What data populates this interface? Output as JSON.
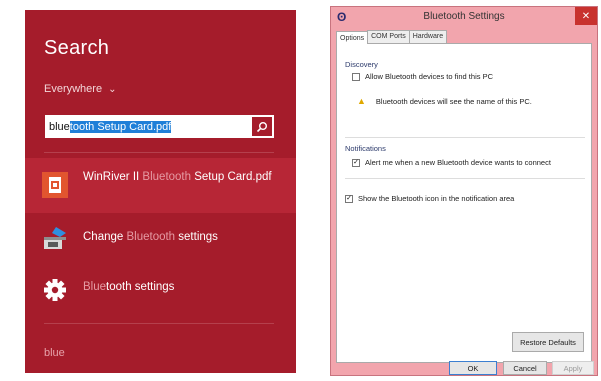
{
  "search": {
    "title": "Search",
    "scope": "Everywhere",
    "query_typed": "blue",
    "query_autocomplete": "tooth Setup Card.pdf",
    "results": [
      {
        "icon": "pdf-file-icon",
        "text_main": "WinRiver II ",
        "text_dim": "Bluetooth",
        "text_after": " Setup Card.pdf"
      },
      {
        "icon": "bluetooth-settings-icon",
        "text_main": "Change ",
        "text_dim": "Bluetooth",
        "text_after": " settings"
      },
      {
        "icon": "gear-icon",
        "text_main": "",
        "text_dim": "Blue",
        "text_after": "tooth settings"
      }
    ],
    "typed_footer": "blue"
  },
  "dialog": {
    "title": "Bluetooth Settings",
    "close_label": "✕",
    "tabs": [
      "Options",
      "COM Ports",
      "Hardware"
    ],
    "discovery": {
      "title": "Discovery",
      "allow_label": "Allow Bluetooth devices to find this PC",
      "allow_checked": false,
      "warning": "Bluetooth devices will see the name of this PC."
    },
    "notifications": {
      "title": "Notifications",
      "alert_label": "Alert me when a new Bluetooth device wants to connect",
      "alert_checked": true
    },
    "show_icon_label": "Show the Bluetooth icon in the notification area",
    "show_icon_checked": true,
    "buttons": {
      "restore": "Restore Defaults",
      "ok": "OK",
      "cancel": "Cancel",
      "apply": "Apply"
    }
  },
  "colors": {
    "charm_bg": "#a51c2b",
    "selection_blue": "#1f7fd8",
    "dialog_frame": "#f2a5ad"
  }
}
